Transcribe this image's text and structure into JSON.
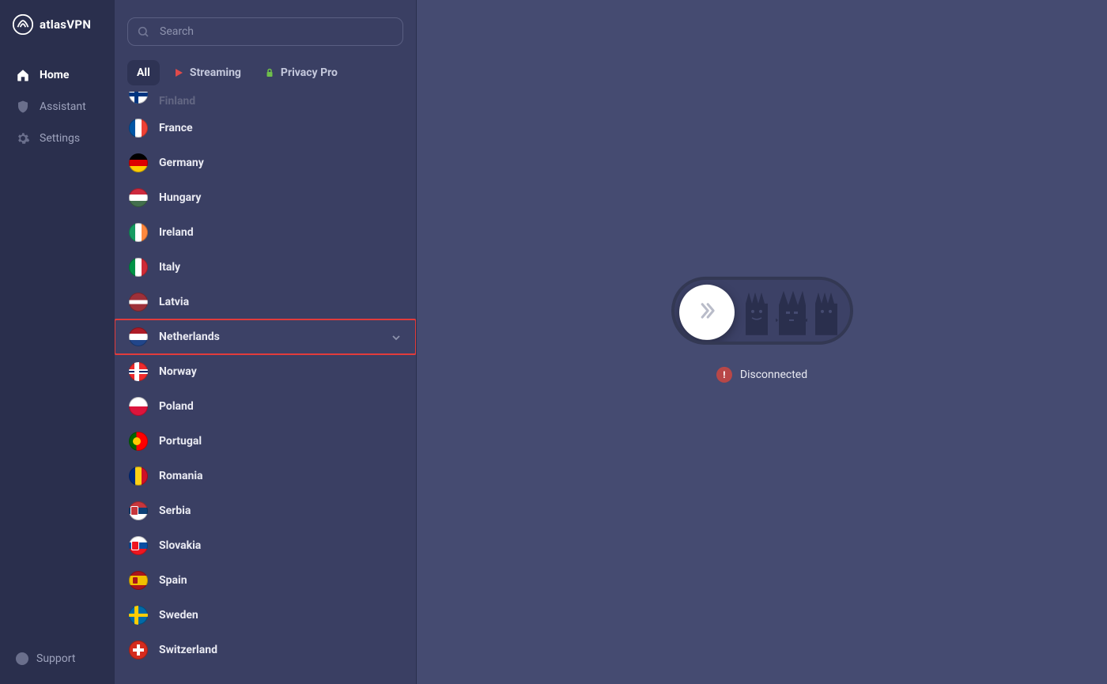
{
  "brand": {
    "name": "atlasVPN"
  },
  "sidebar": {
    "nav": [
      {
        "label": "Home",
        "active": true,
        "icon": "home-icon"
      },
      {
        "label": "Assistant",
        "active": false,
        "icon": "shield-icon"
      },
      {
        "label": "Settings",
        "active": false,
        "icon": "gear-icon"
      }
    ],
    "support_label": "Support"
  },
  "search": {
    "placeholder": "Search",
    "value": ""
  },
  "tabs": [
    {
      "label": "All",
      "active": true
    },
    {
      "label": "Streaming",
      "active": false,
      "icon": "play-icon",
      "icon_color": "#e04a4a"
    },
    {
      "label": "Privacy Pro",
      "active": false,
      "icon": "lock-icon",
      "icon_color": "#6fbf4b"
    }
  ],
  "countries": [
    {
      "label": "Finland",
      "flag": "finland",
      "partial": true
    },
    {
      "label": "France",
      "flag": "france"
    },
    {
      "label": "Germany",
      "flag": "germany"
    },
    {
      "label": "Hungary",
      "flag": "hungary"
    },
    {
      "label": "Ireland",
      "flag": "ireland"
    },
    {
      "label": "Italy",
      "flag": "italy"
    },
    {
      "label": "Latvia",
      "flag": "latvia"
    },
    {
      "label": "Netherlands",
      "flag": "netherlands",
      "selected": true,
      "expandable": true
    },
    {
      "label": "Norway",
      "flag": "norway"
    },
    {
      "label": "Poland",
      "flag": "poland"
    },
    {
      "label": "Portugal",
      "flag": "portugal"
    },
    {
      "label": "Romania",
      "flag": "romania"
    },
    {
      "label": "Serbia",
      "flag": "serbia"
    },
    {
      "label": "Slovakia",
      "flag": "slovakia"
    },
    {
      "label": "Spain",
      "flag": "spain"
    },
    {
      "label": "Sweden",
      "flag": "sweden"
    },
    {
      "label": "Switzerland",
      "flag": "switzerland"
    }
  ],
  "connection": {
    "state": "Disconnected",
    "status_color": "#b84747"
  }
}
